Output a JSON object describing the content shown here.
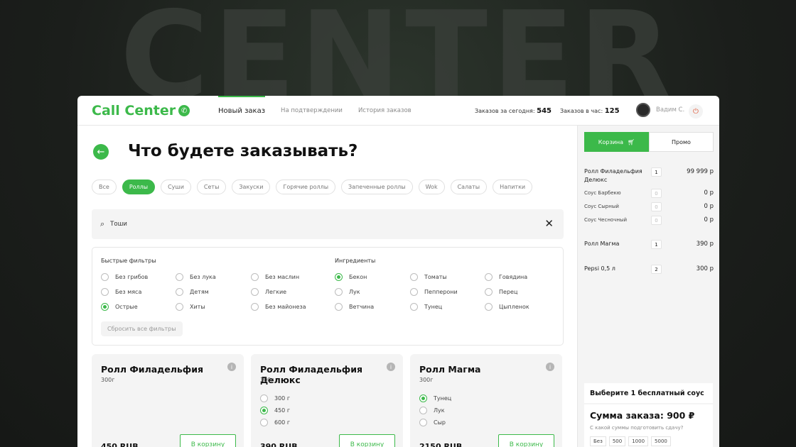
{
  "background": {
    "word": "CENTER"
  },
  "header": {
    "logo": "Call Center",
    "nav": [
      "Новый заказ",
      "На подтверждении",
      "История заказов"
    ],
    "stats": [
      {
        "label": "Заказов за сегодня:",
        "value": "545"
      },
      {
        "label": "Заказов в час:",
        "value": "125"
      }
    ],
    "user_name": "Вадим С."
  },
  "page": {
    "title": "Что будете заказывать?",
    "categories": [
      "Все",
      "Роллы",
      "Суши",
      "Сеты",
      "Закуски",
      "Горячие роллы",
      "Запеченные роллы",
      "Wok",
      "Салаты",
      "Напитки"
    ],
    "active_category": "Роллы"
  },
  "search": {
    "value": "Тоши"
  },
  "filters": {
    "quick_title": "Быстрые фильтры",
    "quick": [
      "Без грибов",
      "Без лука",
      "Без маслин",
      "Без мяса",
      "Детям",
      "Легкие",
      "Острые",
      "Хиты",
      "Без майонеза"
    ],
    "ingredients_title": "Ингредиенты",
    "ingredients": [
      "Бекон",
      "Томаты",
      "Говядина",
      "Лук",
      "Пепперони",
      "Перец",
      "Ветчина",
      "Тунец",
      "Цыпленок"
    ],
    "reset_label": "Сбросить все фильтры"
  },
  "products": [
    {
      "name": "Ролл Филадельфия",
      "weight": "300г",
      "price": "450 RUB",
      "button": "В корзину",
      "options": []
    },
    {
      "name": "Ролл Филадельфия Делюкс",
      "weight": "300г",
      "price": "390 RUB",
      "button": "В корзину",
      "options": [
        "300 г",
        "450 г",
        "600 г"
      ]
    },
    {
      "name": "Ролл Магма",
      "weight": "300г",
      "price": "2150 RUB",
      "button": "В корзину",
      "options": [
        "Тунец",
        "Лук",
        "Сыр"
      ]
    }
  ],
  "cart": {
    "tab_cart": "Корзина",
    "tab_promo": "Промо",
    "items": [
      {
        "name": "Ролл Филадельфия Делюкс",
        "qty": "1",
        "price": "99 999 р"
      },
      {
        "name": "Соус Барбекю",
        "qty": "0",
        "price": "0 р"
      },
      {
        "name": "Соус Сырный",
        "qty": "0",
        "price": "0 р"
      },
      {
        "name": "Соус Чесночный",
        "qty": "0",
        "price": "0 р"
      },
      {
        "name": "Ролл Магма",
        "qty": "1",
        "price": "390 р"
      },
      {
        "name": "Pepsi 0,5 л",
        "qty": "2",
        "price": "300 р"
      }
    ],
    "sauce_prompt": "Выберите 1 бесплатный соус",
    "sum_label": "Сумма заказа: 900 ₽",
    "change_hint": "С какой суммы подготовить сдачу?",
    "change_options": [
      "Без",
      "500",
      "1000",
      "5000"
    ]
  },
  "colors": {
    "accent": "#3cb94a"
  }
}
